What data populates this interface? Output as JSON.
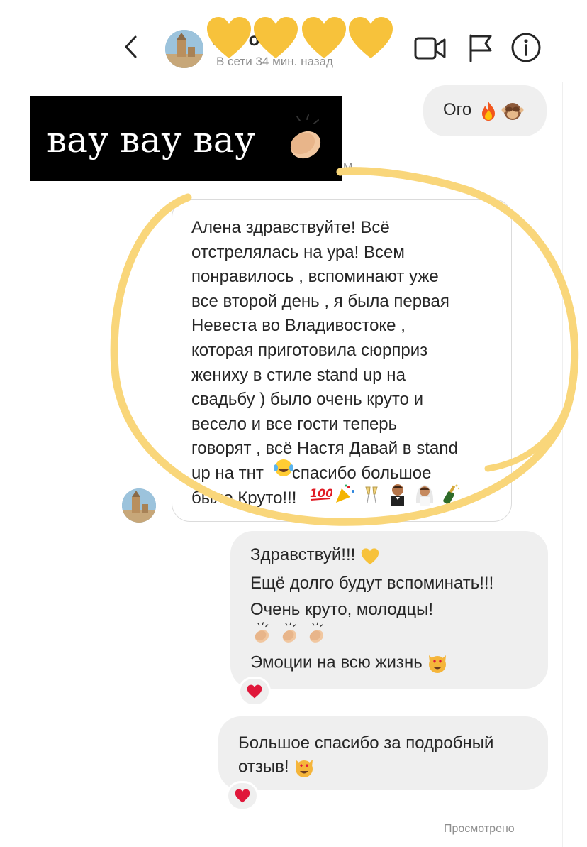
{
  "header": {
    "name": "a   la  o   a",
    "status": "В сети 34 мин. назад"
  },
  "caption": {
    "text": "вау вау вау"
  },
  "messages": {
    "outgoing_1": "Ого",
    "timestamp_stub": "M",
    "incoming": "Алена здравствуйте! Всё\nотстрелялась на ура! Всем\nпонравилось , вспоминают уже\nвсе второй день , я была первая\nНевеста во Владивостоке ,\nкоторая приготовила сюрприз\nжениху в стиле stand up на\nсвадьбу ) было очень круто и\nвесело и все гости теперь\nговорят , всё Настя Давай в stand\nup на тнт      спасибо большое\nбыло Круто!!!",
    "reply_lines": [
      "Здравствуй!!!",
      "Ещё долго будут вспоминать!!!",
      "Очень круто, молодцы!",
      "",
      "Эмоции на всю жизнь"
    ],
    "thanks_lines": [
      "Большое спасибо за подробный",
      "отзыв!"
    ],
    "seen": "Просмотрено"
  },
  "colors": {
    "heart_yellow": "#f7c23b",
    "highlight": "#f9d67a",
    "reaction_heart": "#e0173a",
    "bubble_gray": "#efefef"
  },
  "icons": [
    "chevron-left-icon",
    "video-call-icon",
    "flag-icon",
    "info-icon",
    "yellow-heart-icon",
    "clap-icon",
    "fire-icon",
    "monkey-icon",
    "red-heart-icon",
    "heart-eyes-cat-icon"
  ]
}
